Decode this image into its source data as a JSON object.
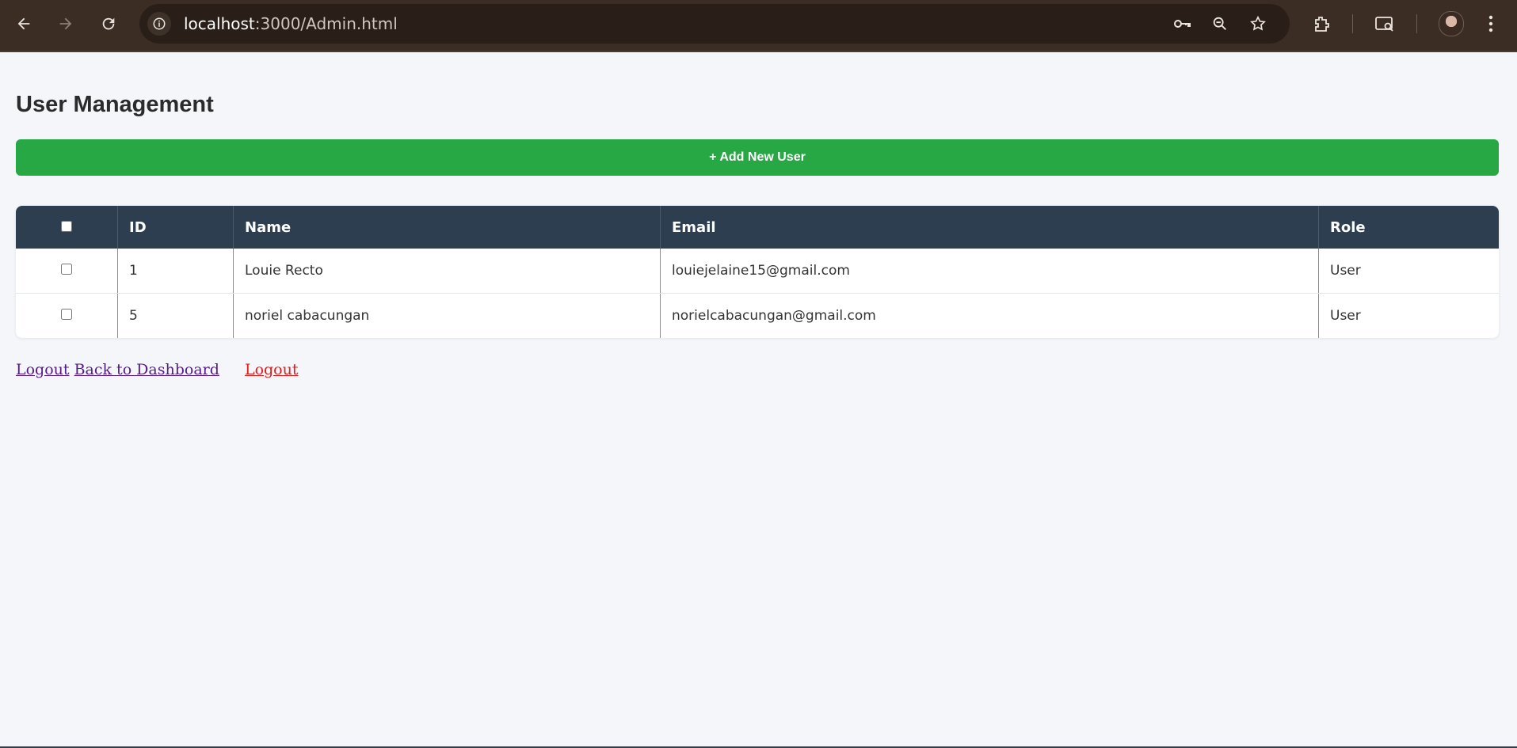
{
  "browser": {
    "url_host": "localhost",
    "url_path": ":3000/Admin.html"
  },
  "page": {
    "title": "User Management",
    "add_button_label": "+ Add New User"
  },
  "table": {
    "headers": [
      "",
      "ID",
      "Name",
      "Email",
      "Role"
    ],
    "rows": [
      {
        "checked": false,
        "id": "1",
        "name": "Louie Recto",
        "email": "louiejelaine15@gmail.com",
        "role": "User"
      },
      {
        "checked": false,
        "id": "5",
        "name": "noriel cabacungan",
        "email": "norielcabacungan@gmail.com",
        "role": "User"
      }
    ]
  },
  "links": {
    "logout_1": "Logout",
    "back_to_dashboard": "Back to Dashboard",
    "logout_2": "Logout"
  },
  "colors": {
    "accent_green": "#28a745",
    "table_header": "#2d3e50",
    "logout_red": "#e21b1b"
  }
}
